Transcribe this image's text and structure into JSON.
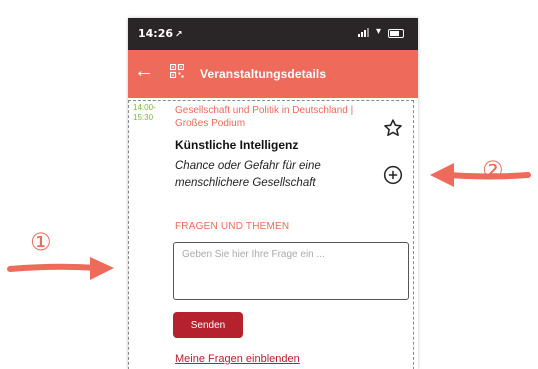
{
  "status_bar": {
    "time": "14:26",
    "nav_glyph": "↗"
  },
  "app_bar": {
    "title": "Veranstaltungsdetails",
    "back_icon": "←"
  },
  "event": {
    "time_range": "14:00-15:30",
    "category": "Gesellschaft und Politik in Deutschland | Großes Podium",
    "title": "Künstliche Intelligenz",
    "subtitle": "Chance oder Gefahr für eine menschlichere Gesellschaft"
  },
  "questions": {
    "section_heading": "FRAGEN UND THEMEN",
    "input_placeholder": "Geben Sie hier Ihre Frage ein ...",
    "input_value": "",
    "send_label": "Senden",
    "show_my_questions": "Meine Fragen einblenden"
  },
  "annotations": {
    "marker_1": "①",
    "marker_2": "②"
  },
  "icons": [
    "back-arrow-icon",
    "qr-code-icon",
    "star-icon",
    "add-circle-icon"
  ],
  "colors": {
    "accent": "#ee6a5b",
    "button": "#b5212d",
    "time_badge": "#7ab83c",
    "status_bar": "#2a2526"
  }
}
